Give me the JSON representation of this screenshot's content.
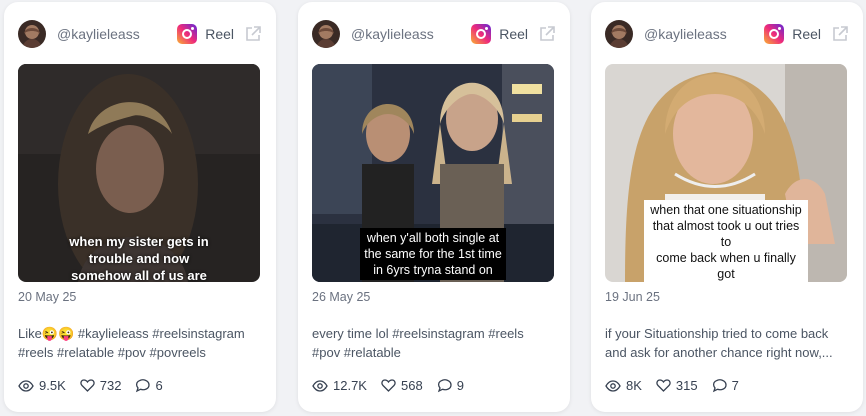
{
  "posts": [
    {
      "username": "@kaylieleass",
      "type_label": "Reel",
      "caption_overlay": "when my sister gets in\ntrouble and now\nsomehow all of us are",
      "date": "20 May 25",
      "description": "Like😜😜 #kaylieleass #reelsinstagram #reels #relatable #pov #povreels",
      "views": "9.5K",
      "likes": "732",
      "comments": "6"
    },
    {
      "username": "@kaylieleass",
      "type_label": "Reel",
      "caption_overlay": "when y'all both single at\nthe same for the 1st time\nin 6yrs tryna stand on",
      "date": "26 May 25",
      "description": "every time lol #reelsinstagram #reels #pov #relatable",
      "views": "12.7K",
      "likes": "568",
      "comments": "9"
    },
    {
      "username": "@kaylieleass",
      "type_label": "Reel",
      "caption_overlay": "when that one situationship\nthat almost took u out tries to\ncome back when u finally got",
      "date": "19 Jun 25",
      "description": "if your Situationship tried to come back and ask for another chance right now,...",
      "views": "8K",
      "likes": "315",
      "comments": "7"
    }
  ],
  "colors": {
    "card_bg": "#ffffff",
    "page_bg": "#f1f2f5",
    "muted_text": "#6b7280"
  },
  "icons": [
    "instagram-icon",
    "external-link-icon",
    "eye-icon",
    "heart-icon",
    "comment-icon"
  ]
}
